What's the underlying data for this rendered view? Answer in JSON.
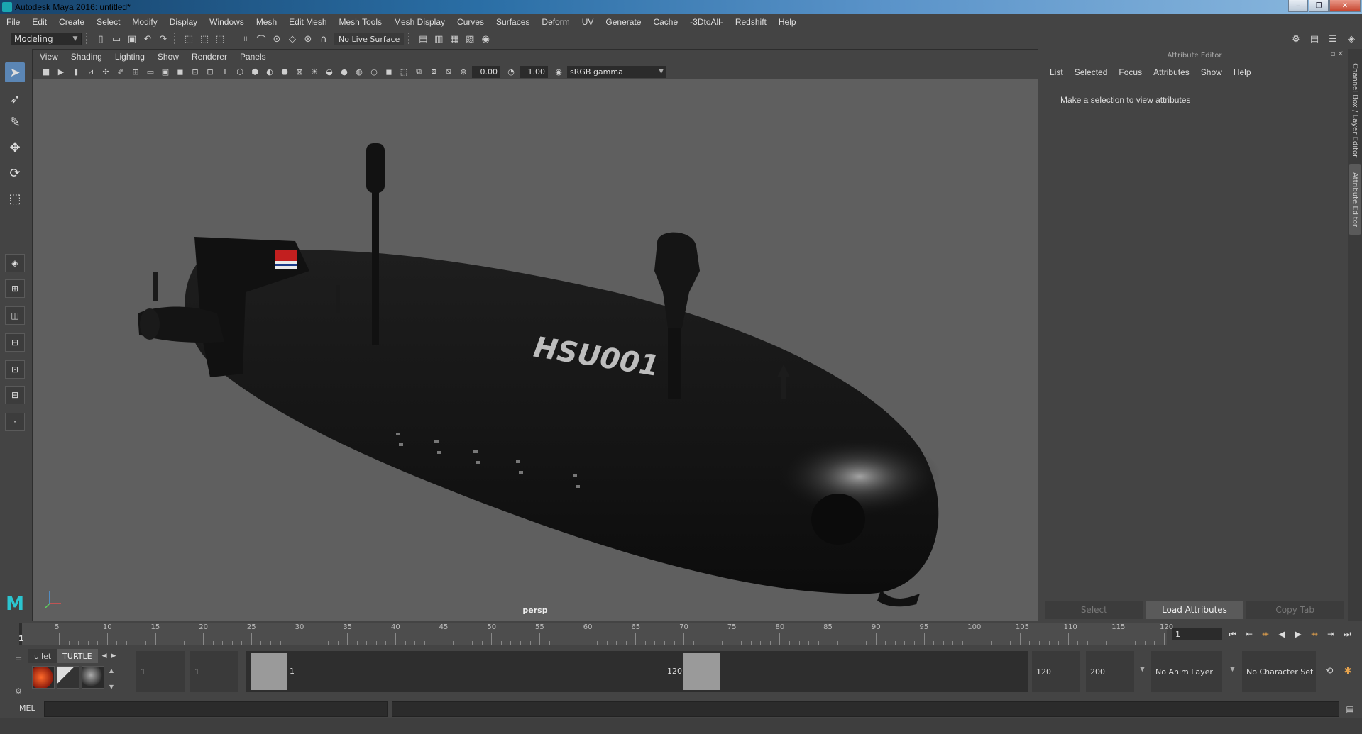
{
  "window": {
    "title": "Autodesk Maya 2016: untitled*",
    "controls": [
      "‒",
      "❐",
      "✕"
    ]
  },
  "menubar": [
    "File",
    "Edit",
    "Create",
    "Select",
    "Modify",
    "Display",
    "Windows",
    "Mesh",
    "Edit Mesh",
    "Mesh Tools",
    "Mesh Display",
    "Curves",
    "Surfaces",
    "Deform",
    "UV",
    "Generate",
    "Cache",
    "-3DtoAll-",
    "Redshift",
    "Help"
  ],
  "statusline": {
    "mode": "Modeling",
    "live_surface": "No Live Surface"
  },
  "panel": {
    "menu": [
      "View",
      "Shading",
      "Lighting",
      "Show",
      "Renderer",
      "Panels"
    ],
    "exposure": "0.00",
    "gamma_value": "1.00",
    "color_space": "sRGB gamma",
    "camera": "persp"
  },
  "model": {
    "hull_text": "HSU001",
    "hull_color": "#151515",
    "background": "#5f5f5f"
  },
  "attribute_editor": {
    "title": "Attribute Editor",
    "menu": [
      "List",
      "Selected",
      "Focus",
      "Attributes",
      "Show",
      "Help"
    ],
    "message": "Make a selection to view attributes",
    "buttons": [
      "Select",
      "Load Attributes",
      "Copy Tab"
    ],
    "active_button": "Load Attributes"
  },
  "side_tabs": [
    "Channel Box / Layer Editor",
    "Attribute Editor"
  ],
  "timeslider": {
    "ticks": [
      5,
      10,
      15,
      20,
      25,
      30,
      35,
      40,
      45,
      50,
      55,
      60,
      65,
      70,
      75,
      80,
      85,
      90,
      95,
      100,
      105,
      110,
      115,
      120
    ],
    "current_frame": "1",
    "current_time_field": "1",
    "min": 1,
    "max": 120
  },
  "shelf": {
    "tabs": [
      "ullet",
      "TURTLE"
    ],
    "active_tab": "TURTLE"
  },
  "range": {
    "start_field": "1",
    "playback_start": "1",
    "range_start_label": "1",
    "range_end_label": "120",
    "playback_end": "120",
    "end_field": "200",
    "anim_layer": "No Anim Layer",
    "character_set": "No Character Set"
  },
  "cmdline": {
    "label": "MEL"
  }
}
